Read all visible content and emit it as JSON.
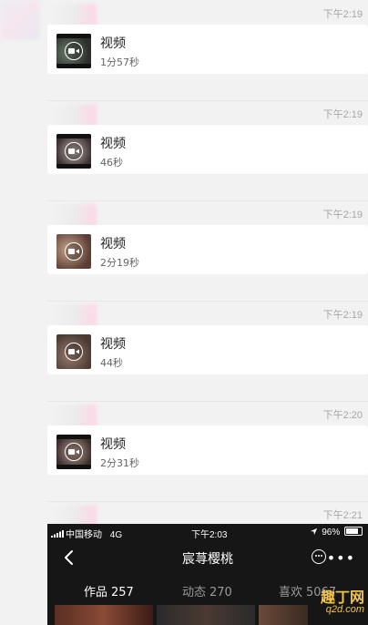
{
  "messages": [
    {
      "time": "下午2:19",
      "title": "视频",
      "duration": "1分57秒"
    },
    {
      "time": "下午2:19",
      "title": "视频",
      "duration": "46秒"
    },
    {
      "time": "下午2:19",
      "title": "视频",
      "duration": "2分19秒"
    },
    {
      "time": "下午2:19",
      "title": "视频",
      "duration": "44秒"
    },
    {
      "time": "下午2:20",
      "title": "视频",
      "duration": "2分31秒"
    },
    {
      "time": "下午2:21"
    }
  ],
  "phone": {
    "status": {
      "carrier": "中国移动",
      "network": "4G",
      "time": "下午2:03",
      "battery": "96%",
      "battery_fraction": 0.96
    },
    "profile_name": "宸荨樱桃",
    "tabs": [
      {
        "label": "作品",
        "count": "257",
        "active": true
      },
      {
        "label": "动态",
        "count": "270",
        "active": false
      },
      {
        "label": "喜欢",
        "count": "5067",
        "active": false
      }
    ],
    "icons": {
      "back": "back-arrow-icon",
      "chat": "chat-bubble-icon",
      "more": "more-icon"
    }
  },
  "watermark": {
    "title": "趣丁网",
    "url": "q2d.com"
  },
  "colors": {
    "accent_watermark": "#f2c44b",
    "card_bg": "#ffffff",
    "page_bg": "#f2f2f2",
    "phone_bg": "#161616"
  }
}
